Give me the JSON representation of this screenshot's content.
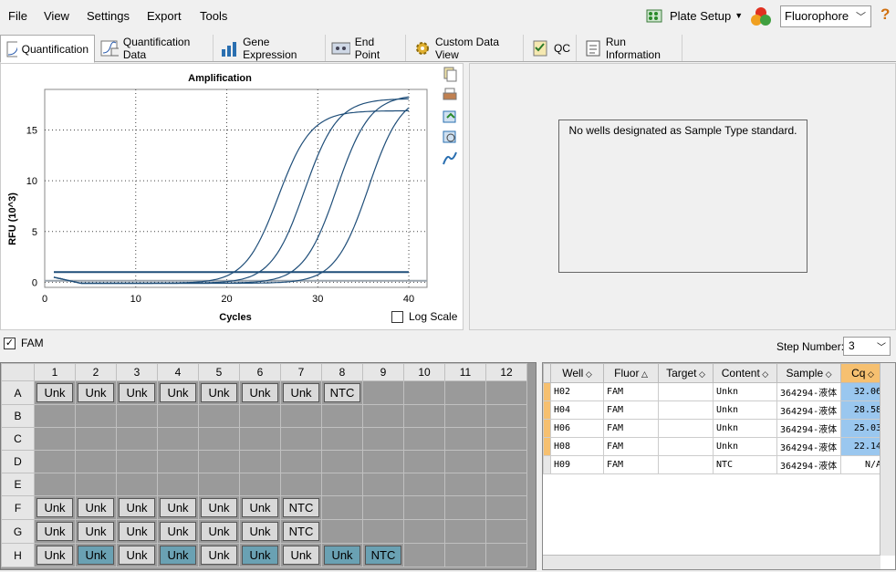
{
  "menu": {
    "file": "File",
    "view": "View",
    "settings": "Settings",
    "export": "Export",
    "tools": "Tools"
  },
  "toolbar": {
    "plate_setup": "Plate Setup",
    "fluorophore": "Fluorophore",
    "help": "?"
  },
  "tabs": [
    "Quantification",
    "Quantification Data",
    "Gene Expression",
    "End Point",
    "Custom Data View",
    "QC",
    "Run Information"
  ],
  "chart": {
    "title": "Amplification",
    "ylabel": "RFU (10^3)",
    "xlabel": "Cycles",
    "log_scale": "Log Scale",
    "xticks": [
      "0",
      "10",
      "20",
      "30",
      "40"
    ],
    "yticks": [
      "0",
      "5",
      "10",
      "15"
    ]
  },
  "chart_data": {
    "type": "line",
    "title": "Amplification",
    "xlabel": "Cycles",
    "ylabel": "RFU (10^3)",
    "xlim": [
      0,
      42
    ],
    "ylim": [
      -0.5,
      19
    ],
    "series": [
      {
        "cq": 22.14,
        "plateau": 17.0
      },
      {
        "cq": 25.03,
        "plateau": 18.2
      },
      {
        "cq": 28.58,
        "plateau": 18.6
      },
      {
        "cq": 32.06,
        "plateau": 18.8
      },
      {
        "cq": 0,
        "plateau": 1.0
      }
    ]
  },
  "standard_message": "No wells designated as Sample Type standard.",
  "fam": {
    "label": "FAM",
    "step_label": "Step Number:",
    "step_value": "3"
  },
  "plate": {
    "cols": [
      "1",
      "2",
      "3",
      "4",
      "5",
      "6",
      "7",
      "8",
      "9",
      "10",
      "11",
      "12"
    ],
    "rows": [
      {
        "label": "A",
        "cells": [
          "Unk",
          "Unk",
          "Unk",
          "Unk",
          "Unk",
          "Unk",
          "Unk",
          "NTC",
          "",
          "",
          "",
          ""
        ],
        "sel": [
          0,
          0,
          0,
          0,
          0,
          0,
          0,
          0,
          0,
          0,
          0,
          0
        ]
      },
      {
        "label": "B",
        "cells": [
          "",
          "",
          "",
          "",
          "",
          "",
          "",
          "",
          "",
          "",
          "",
          ""
        ],
        "sel": [
          0,
          0,
          0,
          0,
          0,
          0,
          0,
          0,
          0,
          0,
          0,
          0
        ]
      },
      {
        "label": "C",
        "cells": [
          "",
          "",
          "",
          "",
          "",
          "",
          "",
          "",
          "",
          "",
          "",
          ""
        ],
        "sel": [
          0,
          0,
          0,
          0,
          0,
          0,
          0,
          0,
          0,
          0,
          0,
          0
        ]
      },
      {
        "label": "D",
        "cells": [
          "",
          "",
          "",
          "",
          "",
          "",
          "",
          "",
          "",
          "",
          "",
          ""
        ],
        "sel": [
          0,
          0,
          0,
          0,
          0,
          0,
          0,
          0,
          0,
          0,
          0,
          0
        ]
      },
      {
        "label": "E",
        "cells": [
          "",
          "",
          "",
          "",
          "",
          "",
          "",
          "",
          "",
          "",
          "",
          ""
        ],
        "sel": [
          0,
          0,
          0,
          0,
          0,
          0,
          0,
          0,
          0,
          0,
          0,
          0
        ]
      },
      {
        "label": "F",
        "cells": [
          "Unk",
          "Unk",
          "Unk",
          "Unk",
          "Unk",
          "Unk",
          "NTC",
          "",
          "",
          "",
          "",
          ""
        ],
        "sel": [
          0,
          0,
          0,
          0,
          0,
          0,
          0,
          0,
          0,
          0,
          0,
          0
        ]
      },
      {
        "label": "G",
        "cells": [
          "Unk",
          "Unk",
          "Unk",
          "Unk",
          "Unk",
          "Unk",
          "NTC",
          "",
          "",
          "",
          "",
          ""
        ],
        "sel": [
          0,
          0,
          0,
          0,
          0,
          0,
          0,
          0,
          0,
          0,
          0,
          0
        ]
      },
      {
        "label": "H",
        "cells": [
          "Unk",
          "Unk",
          "Unk",
          "Unk",
          "Unk",
          "Unk",
          "Unk",
          "Unk",
          "NTC",
          "",
          "",
          ""
        ],
        "sel": [
          0,
          1,
          0,
          1,
          0,
          1,
          0,
          1,
          1,
          0,
          0,
          0
        ]
      }
    ]
  },
  "results": {
    "headers": [
      "Well",
      "Fluor",
      "Target",
      "Content",
      "Sample",
      "Cq"
    ],
    "rows": [
      [
        "H02",
        "FAM",
        "",
        "Unkn",
        "364294-液体",
        "32.06"
      ],
      [
        "H04",
        "FAM",
        "",
        "Unkn",
        "364294-液体",
        "28.58"
      ],
      [
        "H06",
        "FAM",
        "",
        "Unkn",
        "364294-液体",
        "25.03"
      ],
      [
        "H08",
        "FAM",
        "",
        "Unkn",
        "364294-液体",
        "22.14"
      ],
      [
        "H09",
        "FAM",
        "",
        "NTC",
        "364294-液体",
        "N/A"
      ]
    ]
  }
}
